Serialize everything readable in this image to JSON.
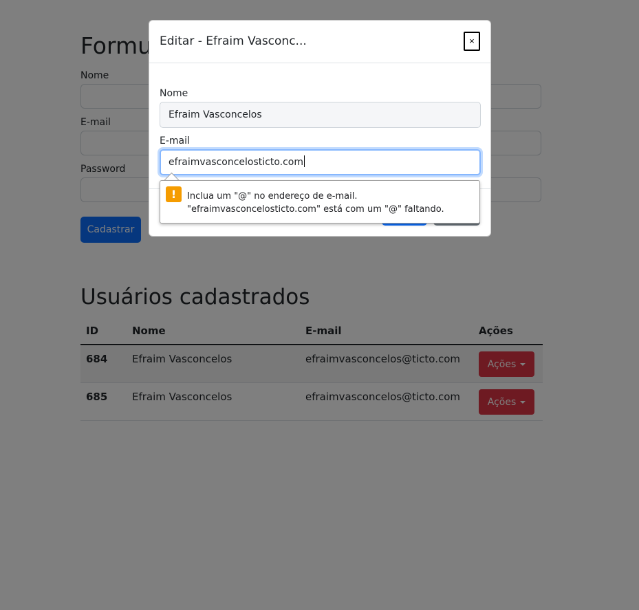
{
  "form": {
    "title": "Formulário de Cadastro",
    "nome_label": "Nome",
    "email_label": "E-mail",
    "password_label": "Password",
    "submit_label": "Cadastrar"
  },
  "users": {
    "title": "Usuários cadastrados",
    "headers": {
      "id": "ID",
      "nome": "Nome",
      "email": "E-mail",
      "acoes": "Ações"
    },
    "rows": [
      {
        "id": "684",
        "nome": "Efraim Vasconcelos",
        "email": "efraimvasconcelos@ticto.com",
        "acoes": "Ações"
      },
      {
        "id": "685",
        "nome": "Efraim Vasconcelos",
        "email": "efraimvasconcelos@ticto.com",
        "acoes": "Ações"
      }
    ]
  },
  "modal": {
    "title": "Editar - Efraim Vasconc...",
    "close": "×",
    "nome_label": "Nome",
    "nome_value": "Efraim Vasconcelos",
    "email_label": "E-mail",
    "email_value": "efraimvasconcelosticto.com"
  },
  "validation": {
    "icon": "!",
    "message": "Inclua um \"@\" no endereço de e-mail. \"efraimvasconcelosticto.com\" está com um \"@\" faltando."
  },
  "colors": {
    "primary": "#0d6efd",
    "danger": "#dc3545",
    "warning": "#f59c00",
    "overlay": "rgba(0,0,0,0.5)"
  }
}
